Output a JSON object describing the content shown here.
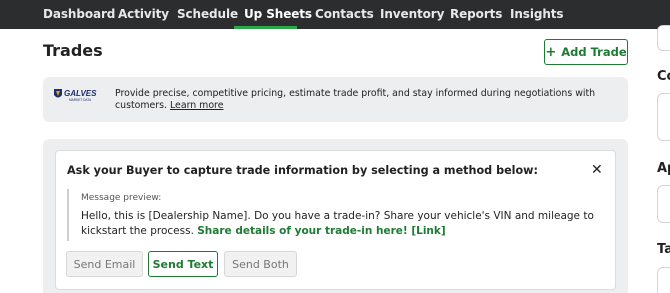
{
  "nav": {
    "items": [
      {
        "label": "Dashboard"
      },
      {
        "label": "Activity"
      },
      {
        "label": "Schedule"
      },
      {
        "label": "Up Sheets"
      },
      {
        "label": "Contacts"
      },
      {
        "label": "Inventory"
      },
      {
        "label": "Reports"
      },
      {
        "label": "Insights"
      }
    ],
    "active": "Up Sheets"
  },
  "page": {
    "title": "Trades",
    "add_trade_label": "Add Trade"
  },
  "banner": {
    "logo_text": "GALVES",
    "logo_subtext": "MARKET DATA",
    "text": "Provide precise, competitive pricing, estimate trade profit, and stay informed during negotiations with customers. ",
    "learn_more": "Learn more"
  },
  "trade_card": {
    "title": "Ask your Buyer to capture trade information by selecting a method below:",
    "preview_label": "Message preview:",
    "message": "Hello, this is [Dealership Name]. Do you have a trade-in? Share your vehicle's VIN and mileage to kickstart the process. ",
    "share_link": "Share details of your trade-in here! [Link]",
    "buttons": {
      "email": "Send Email",
      "text": "Send Text",
      "both": "Send Both"
    }
  },
  "right_col": {
    "labels": [
      "Co",
      "Ap",
      "Ta"
    ]
  },
  "colors": {
    "nav_bg": "#2b2d2f",
    "accent_green": "#1f7a33",
    "active_underline": "#2aa84a",
    "panel_gray": "#eceeef"
  }
}
